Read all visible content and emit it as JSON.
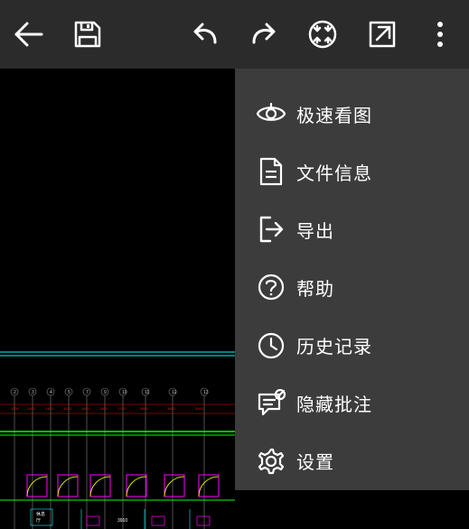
{
  "menu": {
    "fast_view": "极速看图",
    "file_info": "文件信息",
    "export": "导出",
    "help": "帮助",
    "history": "历史记录",
    "hide_annotation": "隐藏批注",
    "settings": "设置"
  }
}
